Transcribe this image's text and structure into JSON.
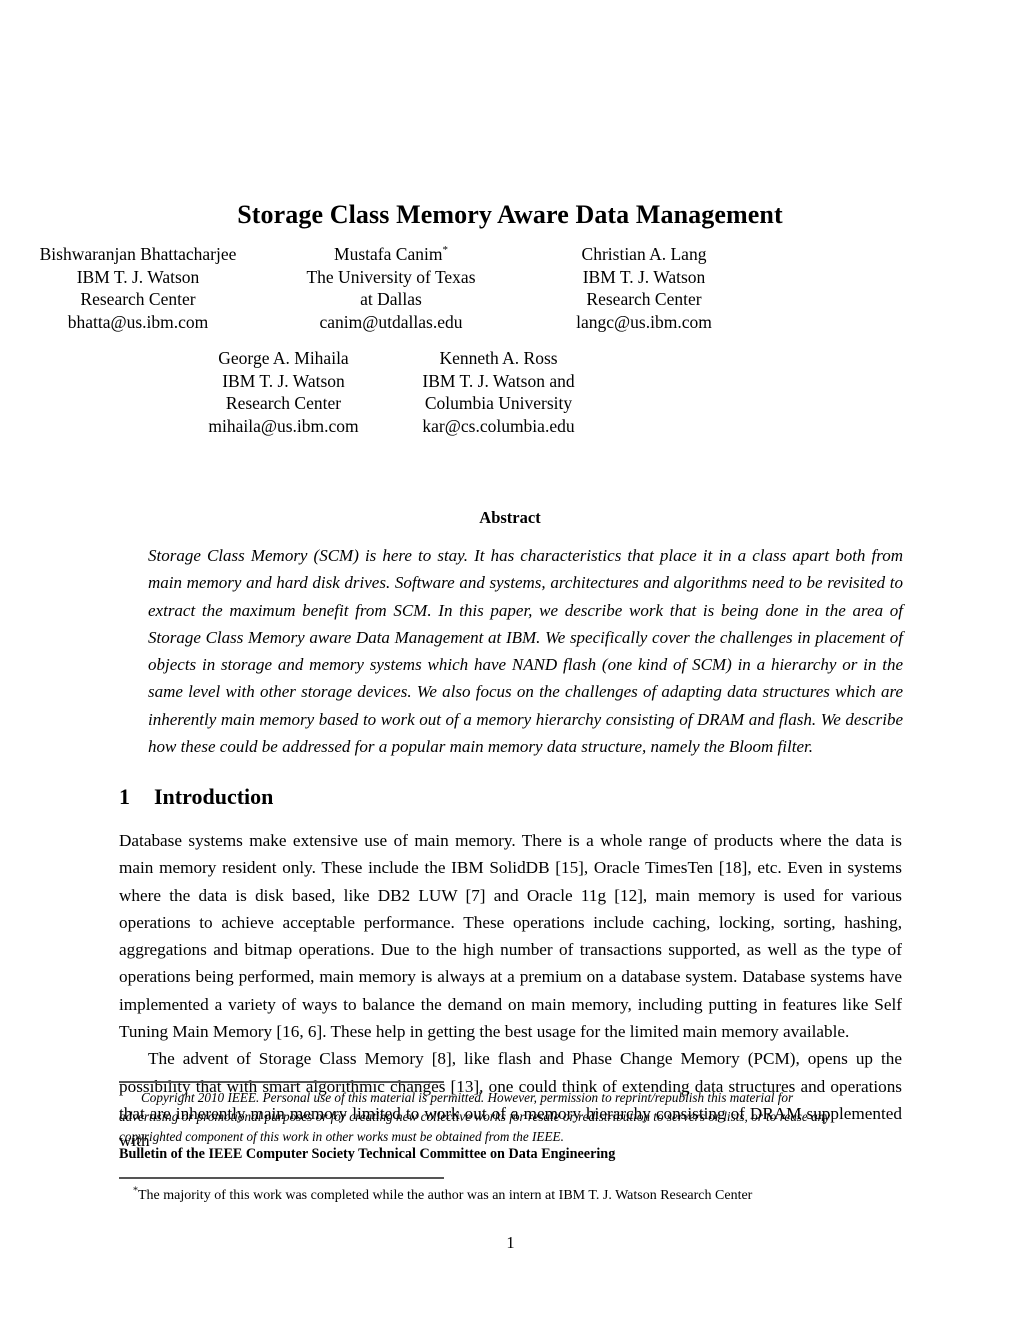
{
  "paper": {
    "title": "Storage Class Memory Aware Data Management",
    "authors_row1": [
      {
        "name": "Bishwaranjan Bhattacharjee",
        "affiliation_line1": "IBM T. J. Watson",
        "affiliation_line2": "Research Center",
        "email": "bhatta@us.ibm.com",
        "footnote_marker": ""
      },
      {
        "name": "Mustafa Canim",
        "affiliation_line1": "The University of Texas",
        "affiliation_line2": "at Dallas",
        "email": "canim@utdallas.edu",
        "footnote_marker": "*"
      },
      {
        "name": "Christian A. Lang",
        "affiliation_line1": "IBM T. J. Watson",
        "affiliation_line2": "Research Center",
        "email": "langc@us.ibm.com",
        "footnote_marker": ""
      }
    ],
    "authors_row2": [
      {
        "name": "George A. Mihaila",
        "affiliation_line1": "IBM T. J. Watson",
        "affiliation_line2": "Research Center",
        "email": "mihaila@us.ibm.com",
        "footnote_marker": ""
      },
      {
        "name": "Kenneth A. Ross",
        "affiliation_line1": "IBM T. J. Watson and",
        "affiliation_line2": "Columbia University",
        "email": "kar@cs.columbia.edu",
        "footnote_marker": ""
      }
    ],
    "abstract": {
      "heading": "Abstract",
      "text": "Storage Class Memory (SCM) is here to stay. It has characteristics that place it in a class apart both from main memory and hard disk drives. Software and systems, architectures and algorithms need to be revisited to extract the maximum benefit from SCM. In this paper, we describe work that is being done in the area of Storage Class Memory aware Data Management at IBM. We specifically cover the challenges in placement of objects in storage and memory systems which have NAND flash (one kind of SCM) in a hierarchy or in the same level with other storage devices. We also focus on the challenges of adapting data structures which are inherently main memory based to work out of a memory hierarchy consisting of DRAM and flash. We describe how these could be addressed for a popular main memory data structure, namely the Bloom filter."
    },
    "section": {
      "number": "1",
      "title": "Introduction",
      "paragraph1": "Database systems make extensive use of main memory. There is a whole range of products where the data is main memory resident only. These include the IBM SolidDB [15], Oracle TimesTen [18], etc. Even in systems where the data is disk based, like DB2 LUW [7] and Oracle 11g [12], main memory is used for various operations to achieve acceptable performance. These operations include caching, locking, sorting, hashing, aggregations and bitmap operations. Due to the high number of transactions supported, as well as the type of operations being performed, main memory is always at a premium on a database system. Database systems have implemented a variety of ways to balance the demand on main memory, including putting in features like Self Tuning Main Memory [16, 6]. These help in getting the best usage for the limited main memory available.",
      "paragraph2": "The advent of Storage Class Memory [8], like flash and Phase Change Memory (PCM), opens up the possibility that with smart algorithmic changes [13], one could think of extending data structures and operations that are inherently main memory limited to work out of a memory hierarchy consisting of DRAM supplemented with"
    },
    "footer": {
      "copyright_line1": "Copyright 2010 IEEE. Personal use of this material is permitted. However, permission to reprint/republish this material for",
      "copyright_line2": "advertising or promotional purposes or for creating new collective works for resale or redistribution to servers or lists, or to reuse any",
      "copyright_line3": "copyrighted component of this work in other works must be obtained from the IEEE.",
      "bulletin": "Bulletin of the IEEE Computer Society Technical Committee on Data Engineering",
      "star_marker": "*",
      "star_footnote": "The majority of this work was completed while the author was an intern at IBM T. J. Watson Research Center",
      "page_number": "1"
    }
  }
}
